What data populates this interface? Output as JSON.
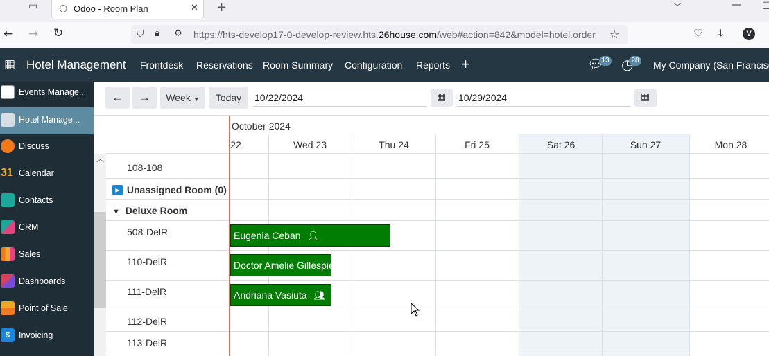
{
  "browser": {
    "tab_title": "Odoo - Room Plan",
    "url_prefix": "https://hts-develop17-0-develop-review.hts.",
    "url_domain": "26house.com",
    "url_suffix": "/web#action=842&model=hotel.order",
    "profile_initial": "V"
  },
  "navbar": {
    "app_name": "Hotel Management",
    "menus": [
      "Frontdesk",
      "Reservations",
      "Room Summary",
      "Configuration",
      "Reports"
    ],
    "add_symbol": "+",
    "messages_count": "13",
    "activities_count": "28",
    "company": "My Company (San Francisco)"
  },
  "sidebar": {
    "items": [
      {
        "label": "Events Manage...",
        "icon": "events-icon",
        "color": "#ffffff"
      },
      {
        "label": "Hotel Manage...",
        "icon": "hotel-icon",
        "color": "#d7dde2",
        "active": true
      },
      {
        "label": "Discuss",
        "icon": "discuss-icon",
        "color": "#f07a1a"
      },
      {
        "label": "Calendar",
        "icon": "calendar-icon",
        "color": "#f2a922"
      },
      {
        "label": "Contacts",
        "icon": "contacts-icon",
        "color": "#19a89a"
      },
      {
        "label": "CRM",
        "icon": "crm-icon",
        "color": "#19a89a"
      },
      {
        "label": "Sales",
        "icon": "sales-icon",
        "color": "#f07a1a"
      },
      {
        "label": "Dashboards",
        "icon": "dashboards-icon",
        "color": "#d9405a"
      },
      {
        "label": "Point of Sale",
        "icon": "pos-icon",
        "color": "#f07a1a"
      },
      {
        "label": "Invoicing",
        "icon": "invoicing-icon",
        "color": "#1a86d8"
      }
    ],
    "calendar_number": "31"
  },
  "toolbar": {
    "prev": "←",
    "next": "→",
    "scale": "Week",
    "today": "Today",
    "start_date": "10/22/2024",
    "end_date": "10/29/2024"
  },
  "planner": {
    "month": "October 2024",
    "days": [
      "22",
      "Wed 23",
      "Thu 24",
      "Fri 25",
      "Sat 26",
      "Sun 27",
      "Mon 28"
    ],
    "rows": {
      "r0": "108-108",
      "unassigned": "Unassigned Room (0)",
      "group": "Deluxe Room",
      "r1": "508-DelR",
      "r2": "110-DelR",
      "r3": "111-DelR",
      "r4": "112-DelR",
      "r5": "113-DelR"
    },
    "bookings": [
      {
        "guest": "Eugenia Ceban",
        "icon": "single-user-icon"
      },
      {
        "guest": "Doctor Amelie Gillespie",
        "icon": "none"
      },
      {
        "guest": "Andriana Vasiuta",
        "icon": "group-users-icon"
      }
    ],
    "booking_color": "#017e01",
    "weekend_color": "#eef3f7",
    "today_line_color": "#e46a6a"
  }
}
